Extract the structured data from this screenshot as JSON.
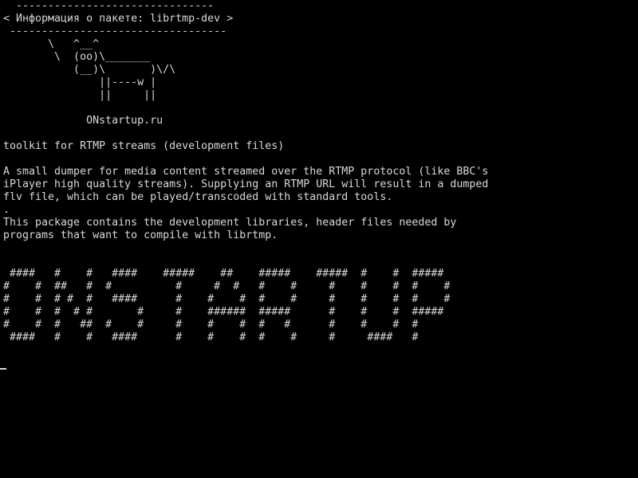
{
  "terminal": {
    "lines": [
      "  -------------------------------",
      "< Информация о пакете: librtmp-dev >",
      " ----------------------------------",
      "       \\   ^__^",
      "        \\  (oo)\\_______",
      "           (__)\\       )\\/\\",
      "               ||----w |",
      "               ||     ||",
      "",
      "             ONstartup.ru",
      "",
      "toolkit for RTMP streams (development files)",
      "",
      "A small dumper for media content streamed over the RTMP protocol (like BBC's",
      "iPlayer high quality streams). Supplying an RTMP URL will result in a dumped",
      "flv file, which can be played/transcoded with standard tools.",
      ".",
      "This package contains the development libraries, header files needed by",
      "programs that want to compile with librtmp.",
      "",
      "",
      " ####   #    #   ####    #####    ##    #####    #####  #    #  #####",
      "#    #  ##   #  #          #     #  #   #    #     #    #    #  #    #",
      "#    #  # #  #   ####      #    #    #  #    #     #    #    #  #    #",
      "#    #  #  # #       #     #    ######  #####      #    #    #  #####",
      "#    #  #   ##  #    #     #    #    #  #   #      #    #    #  #",
      " ####   #    #   ####      #    #    #  #    #     #     ####   #"
    ],
    "cursor_visible": true,
    "fg_color": "#d9d9d9",
    "bg_color": "#000000"
  }
}
